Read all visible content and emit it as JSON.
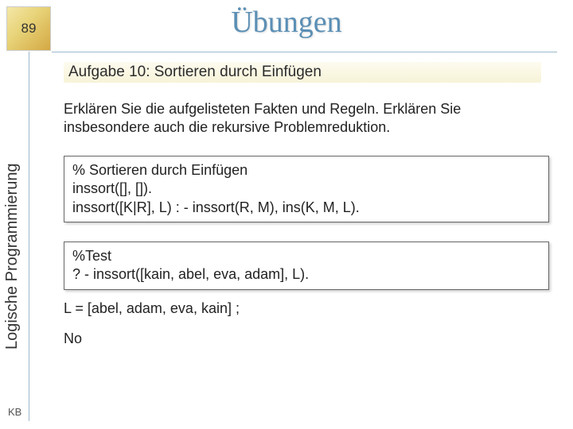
{
  "slide": {
    "number": "89",
    "title": "Übungen",
    "footer": "KB"
  },
  "sidebar": {
    "label": "Logische Programmierung"
  },
  "content": {
    "subtitle": "Aufgabe 10: Sortieren durch Einfügen",
    "instruction": "Erklären Sie die aufgelisteten Fakten und Regeln. Erklären Sie insbesondere auch die rekursive Problemreduktion.",
    "codebox1": {
      "line1": "% Sortieren durch Einfügen",
      "line2": "inssort([], []).",
      "line3": "inssort([K|R], L) : - inssort(R, M), ins(K, M, L)."
    },
    "codebox2": {
      "line1": "%Test",
      "line2": "? - inssort([kain, abel, eva, adam], L)."
    },
    "result1": "L = [abel, adam, eva, kain] ;",
    "result2": "No"
  }
}
